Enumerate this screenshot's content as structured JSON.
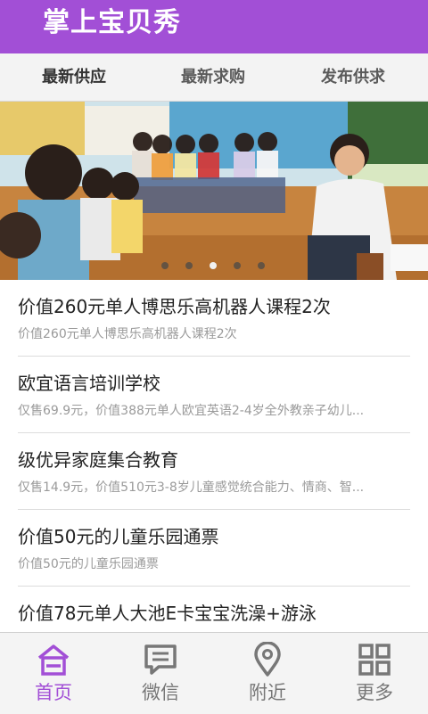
{
  "header": {
    "title": "掌上宝贝秀"
  },
  "tabs": [
    {
      "label": "最新供应",
      "active": true
    },
    {
      "label": "最新求购",
      "active": false
    },
    {
      "label": "发布供求",
      "active": false
    }
  ],
  "banner": {
    "total_slides": 5,
    "active_slide": 3
  },
  "list": [
    {
      "title": "价值260元单人博思乐高机器人课程2次",
      "subtitle": "价值260元单人博思乐高机器人课程2次"
    },
    {
      "title": "欧宜语言培训学校",
      "subtitle": "仅售69.9元，价值388元单人欧宜英语2-4岁全外教亲子幼儿..."
    },
    {
      "title": "级优异家庭集合教育",
      "subtitle": "仅售14.9元，价值510元3-8岁儿童感觉统合能力、情商、智..."
    },
    {
      "title": "价值50元的儿童乐园通票",
      "subtitle": "价值50元的儿童乐园通票"
    },
    {
      "title": "价值78元单人大池E卡宝宝洗澡+游泳",
      "subtitle": ""
    }
  ],
  "bottom_nav": [
    {
      "label": "首页",
      "icon": "home-icon",
      "active": true
    },
    {
      "label": "微信",
      "icon": "chat-icon",
      "active": false
    },
    {
      "label": "附近",
      "icon": "location-pin-icon",
      "active": false
    },
    {
      "label": "更多",
      "icon": "grid-icon",
      "active": false
    }
  ],
  "colors": {
    "brand": "#a24fd6",
    "inactive": "#777777"
  }
}
